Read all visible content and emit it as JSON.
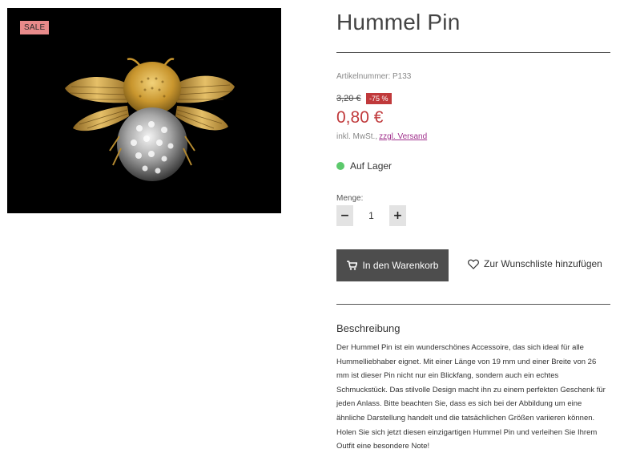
{
  "image": {
    "badge": "SALE",
    "alt": "Hummel Pin"
  },
  "product": {
    "title": "Hummel Pin",
    "sku": "Artikelnummer: P133",
    "old_price": "3,20 €",
    "discount": "-75 %",
    "price": "0,80 €",
    "tax_text": "inkl. MwSt.,",
    "shipping_link": "zzgl. Versand",
    "stock": "Auf Lager"
  },
  "quantity": {
    "label": "Menge:",
    "value": "1",
    "minus": "−",
    "plus": "+"
  },
  "actions": {
    "cart_label": "In den Warenkorb",
    "wishlist_label": "Zur Wunschliste hinzufügen"
  },
  "description": {
    "heading": "Beschreibung",
    "text": "Der Hummel Pin ist ein wunderschönes Accessoire, das sich ideal für alle Hummelliebhaber eignet. Mit einer Länge von 19 mm und einer Breite von 26 mm ist dieser Pin nicht nur ein Blickfang, sondern auch ein echtes Schmuckstück. Das stilvolle Design macht ihn zu einem perfekten Geschenk für jeden Anlass. Bitte beachten Sie, dass es sich bei der Abbildung um eine ähnliche Darstellung handelt und die tatsächlichen Größen variieren können. Holen Sie sich jetzt diesen einzigartigen Hummel Pin und verleihen Sie Ihrem Outfit eine besondere Note!"
  },
  "colors": {
    "sale_badge": "#e88a8a",
    "price": "#c0393b",
    "stock_ok": "#5cc96c",
    "cart_button": "#4d4d4d",
    "link": "#a0308c"
  }
}
